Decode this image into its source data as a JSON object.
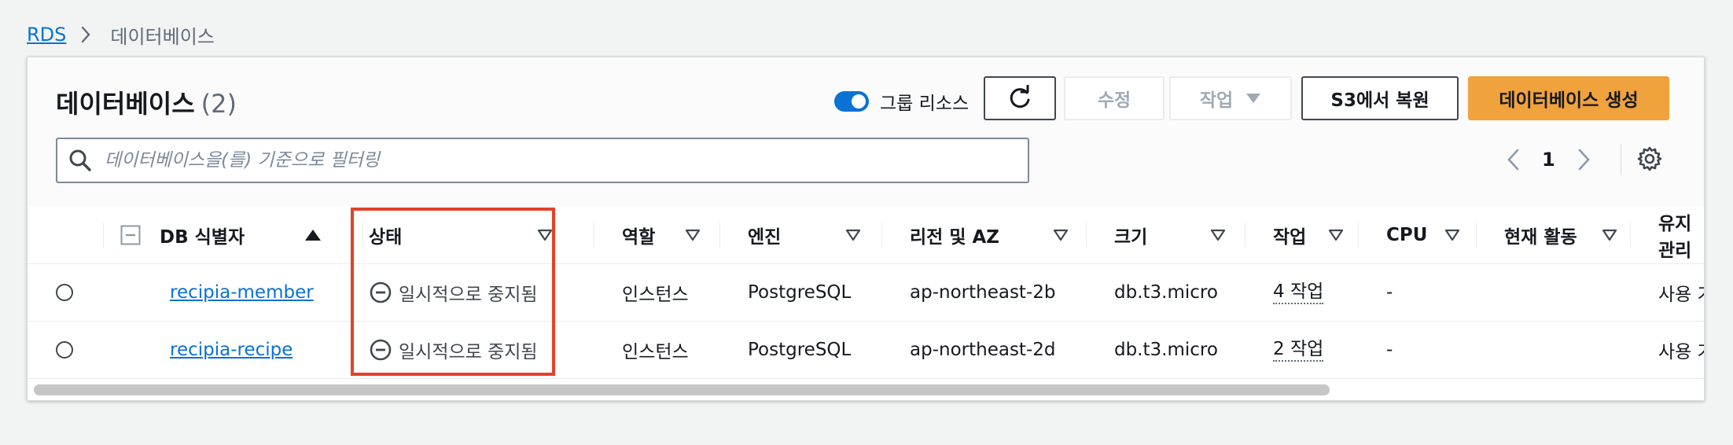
{
  "breadcrumb": {
    "root": "RDS",
    "current": "데이터베이스"
  },
  "header": {
    "title": "데이터베이스",
    "count": "(2)",
    "group_toggle_label": "그룹 리소스",
    "edit_label": "수정",
    "action_label": "작업",
    "restore_label": "S3에서 복원",
    "create_label": "데이터베이스 생성"
  },
  "search": {
    "placeholder": "데이터베이스을(를) 기준으로 필터링",
    "value": ""
  },
  "pagination": {
    "page": "1"
  },
  "table": {
    "columns": {
      "db_identifier": "DB 식별자",
      "status": "상태",
      "role": "역할",
      "engine": "엔진",
      "region_az": "리전 및 AZ",
      "size": "크기",
      "actions": "작업",
      "cpu": "CPU",
      "current_activity": "현재 활동",
      "maintenance": "유지 관리"
    },
    "rows": [
      {
        "identifier": "recipia-member",
        "status": "일시적으로 중지됨",
        "role": "인스턴스",
        "engine": "PostgreSQL",
        "region_az": "ap-northeast-2b",
        "size": "db.t3.micro",
        "actions": "4 작업",
        "cpu": "-",
        "maintenance": "사용 가능"
      },
      {
        "identifier": "recipia-recipe",
        "status": "일시적으로 중지됨",
        "role": "인스턴스",
        "engine": "PostgreSQL",
        "region_az": "ap-northeast-2d",
        "size": "db.t3.micro",
        "actions": "2 작업",
        "cpu": "-",
        "maintenance": "사용 가능"
      }
    ]
  },
  "colors": {
    "primary_button": "#f0a23c",
    "link": "#0972d3",
    "highlight_box": "#e2422b"
  },
  "icons": [
    "chevron-right-icon",
    "refresh-icon",
    "caret-down-icon",
    "search-icon",
    "chevron-left-icon",
    "gear-icon",
    "collapse-icon",
    "sort-ascending-icon",
    "sort-icon",
    "stopped-status-icon"
  ]
}
